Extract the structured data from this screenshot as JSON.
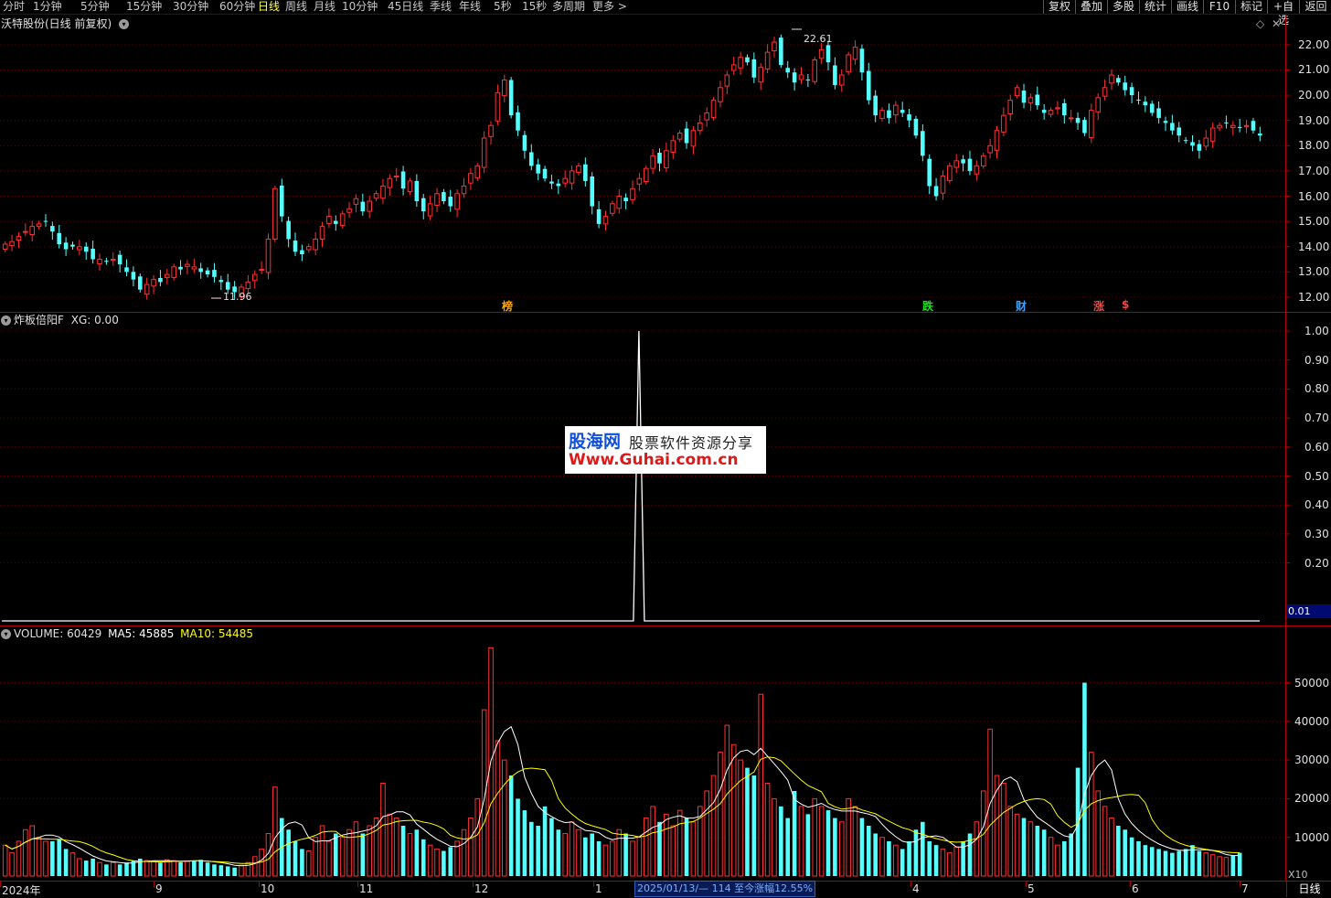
{
  "toolbar": {
    "periods": [
      "分时",
      "1分钟",
      "5分钟",
      "15分钟",
      "30分钟",
      "60分钟",
      "日线",
      "周线",
      "月线",
      "10分钟",
      "45日线",
      "季线",
      "年线",
      "5秒",
      "15秒",
      "多周期",
      "更多 >"
    ],
    "active": "日线",
    "right_buttons": [
      "复权",
      "叠加",
      "多股",
      "统计",
      "画线",
      "F10",
      "标记",
      "+自选",
      "返回"
    ]
  },
  "stock_title": "沃特股份(日线 前复权)",
  "price_panel": {
    "high_label": "22.61",
    "low_label": "11.96",
    "y_ticks": [
      "22.00",
      "21.00",
      "20.00",
      "19.00",
      "18.00",
      "17.00",
      "16.00",
      "15.00",
      "14.00",
      "13.00",
      "12.00"
    ],
    "markers": [
      {
        "text": "榜",
        "color": "#ffa500"
      },
      {
        "text": "跌",
        "color": "#20e020"
      },
      {
        "text": "财",
        "color": "#40a0ff"
      },
      {
        "text": "涨",
        "color": "#ff4040"
      },
      {
        "text": "$",
        "color": "#ff4040"
      }
    ]
  },
  "indicator_panel": {
    "title": "炸板倍阳F",
    "xg_label": "XG: 0.00",
    "y_ticks": [
      "1.00",
      "0.90",
      "0.80",
      "0.70",
      "0.60",
      "0.50",
      "0.40",
      "0.30",
      "0.20"
    ],
    "current_value": "0.01"
  },
  "volume_panel": {
    "volume_label": "VOLUME: 60429",
    "ma5_label": "MA5: 45885",
    "ma10_label": "MA10: 54485",
    "y_ticks": [
      "50000",
      "40000",
      "30000",
      "20000",
      "10000"
    ],
    "unit": "X10"
  },
  "x_axis": {
    "labels": [
      "2024年",
      "9",
      "10",
      "11",
      "12",
      "1",
      "4",
      "5",
      "6",
      "7"
    ]
  },
  "bottom_info": "2025/01/13/— 114 至今涨幅12.55%",
  "period_box": "日线",
  "watermark": {
    "line1": "股海网",
    "line1_sub": "股票软件资源分享",
    "line2": "Www.Guhai.com.cn"
  },
  "colors": {
    "up": "#ff3030",
    "down": "#54ffff",
    "grid_red": "#b00000",
    "ma5": "#ffffff",
    "ma10": "#ffff00",
    "active_tab": "#ffff50"
  },
  "chart_data": [
    {
      "type": "candlestick",
      "title": "沃特股份(日线 前复权)",
      "y_ticks": [
        12,
        13,
        14,
        15,
        16,
        17,
        18,
        19,
        20,
        21,
        22
      ],
      "ylim": [
        11.6,
        22.9
      ],
      "high": 22.61,
      "low": 11.96,
      "closes": [
        14.1,
        14.2,
        14.4,
        14.6,
        14.8,
        14.9,
        15.0,
        14.6,
        14.1,
        13.9,
        14.0,
        14.0,
        13.8,
        13.5,
        13.5,
        13.4,
        13.5,
        13.3,
        13.0,
        12.7,
        12.3,
        12.5,
        12.7,
        12.6,
        12.9,
        13.2,
        13.1,
        13.3,
        13.2,
        13.0,
        12.9,
        12.8,
        12.6,
        12.3,
        12.2,
        12.4,
        12.6,
        12.9,
        13.1,
        14.3,
        16.3,
        15.2,
        14.3,
        13.8,
        13.7,
        14.0,
        14.3,
        14.8,
        15.2,
        14.9,
        15.3,
        15.5,
        15.9,
        15.4,
        15.8,
        16.1,
        16.4,
        16.7,
        16.8,
        16.3,
        16.6,
        15.8,
        15.4,
        15.7,
        16.1,
        15.8,
        15.6,
        16.1,
        16.4,
        16.9,
        17.2,
        18.3,
        18.8,
        20.1,
        20.6,
        19.2,
        18.6,
        17.8,
        17.2,
        16.9,
        16.7,
        16.5,
        16.4,
        16.7,
        17.0,
        17.2,
        16.6,
        15.6,
        14.9,
        15.2,
        15.7,
        16.0,
        15.8,
        16.3,
        16.7,
        17.1,
        17.6,
        17.3,
        17.8,
        18.2,
        18.5,
        18.1,
        18.6,
        18.9,
        19.3,
        19.8,
        20.3,
        20.8,
        21.2,
        21.5,
        21.3,
        20.7,
        21.1,
        21.7,
        22.1,
        21.2,
        20.9,
        20.5,
        20.8,
        20.6,
        21.4,
        21.8,
        21.3,
        20.4,
        20.8,
        21.6,
        21.9,
        20.9,
        19.8,
        19.2,
        19.4,
        19.1,
        19.6,
        19.3,
        19.0,
        18.4,
        17.6,
        16.4,
        16.0,
        16.8,
        17.2,
        17.4,
        17.3,
        17.0,
        17.2,
        17.6,
        18.0,
        18.6,
        19.2,
        19.8,
        20.3,
        19.7,
        19.9,
        19.6,
        19.3,
        19.4,
        19.5,
        19.2,
        19.1,
        18.9,
        18.5,
        19.4,
        19.9,
        20.3,
        20.8,
        20.5,
        20.2,
        20.0,
        19.8,
        19.6,
        19.3,
        19.1,
        18.9,
        18.6,
        18.4,
        18.2,
        18.0,
        17.8,
        18.3,
        18.7,
        18.8,
        18.9,
        18.8,
        18.7,
        18.8,
        18.6,
        18.4
      ]
    },
    {
      "type": "line",
      "title": "炸板倍阳F",
      "ylim": [
        0,
        1
      ],
      "series": [
        {
          "name": "XG",
          "spike_at_fraction": 0.505,
          "spike_value": 1.0
        }
      ]
    },
    {
      "type": "bar",
      "title": "VOLUME",
      "unit": "X10",
      "y_ticks": [
        10000,
        20000,
        30000,
        40000,
        50000
      ],
      "ylim": [
        0,
        61000
      ],
      "values": [
        8000,
        6000,
        9000,
        12000,
        13000,
        10000,
        9000,
        9000,
        9500,
        7000,
        6000,
        4500,
        4000,
        4500,
        3500,
        3000,
        3500,
        3000,
        3500,
        4000,
        4500,
        4000,
        3800,
        3500,
        4200,
        4000,
        3600,
        3800,
        4000,
        4200,
        3500,
        3000,
        2800,
        2500,
        2200,
        2800,
        3500,
        5000,
        7000,
        11000,
        23000,
        15000,
        12000,
        9000,
        7000,
        6500,
        10000,
        13000,
        9000,
        11000,
        10000,
        12000,
        14000,
        11000,
        13000,
        15000,
        24000,
        16000,
        15000,
        13000,
        11000,
        12000,
        9500,
        8000,
        7000,
        6500,
        7500,
        9000,
        12000,
        15000,
        20000,
        43000,
        59000,
        35000,
        30000,
        26000,
        20000,
        17000,
        14000,
        13000,
        18000,
        15000,
        12000,
        11000,
        14000,
        12000,
        10000,
        11000,
        9000,
        8000,
        9000,
        12000,
        11000,
        9000,
        10000,
        15000,
        18000,
        14000,
        16000,
        13000,
        17000,
        15000,
        14000,
        18000,
        22000,
        26000,
        32000,
        39000,
        34000,
        30000,
        28000,
        26000,
        47000,
        24000,
        20000,
        18000,
        15000,
        22000,
        18000,
        16000,
        20000,
        18000,
        17000,
        15000,
        14000,
        20000,
        18000,
        15000,
        13000,
        11000,
        10000,
        9000,
        8000,
        7000,
        9000,
        12000,
        14000,
        9000,
        8000,
        7000,
        6000,
        7500,
        9000,
        11000,
        14000,
        22000,
        38000,
        26000,
        24000,
        18000,
        16000,
        15000,
        14000,
        13000,
        12000,
        10000,
        8000,
        9000,
        11000,
        28000,
        50000,
        32000,
        22000,
        18000,
        15000,
        13000,
        12000,
        10000,
        9000,
        8000,
        7500,
        7000,
        6500,
        6000,
        6500,
        7000,
        8000,
        6500,
        6000,
        5500,
        5000,
        4800,
        5200,
        6000
      ]
    },
    {
      "type": "line",
      "title": "VOLUME MA",
      "series": [
        {
          "name": "MA5"
        },
        {
          "name": "MA10"
        }
      ]
    }
  ]
}
